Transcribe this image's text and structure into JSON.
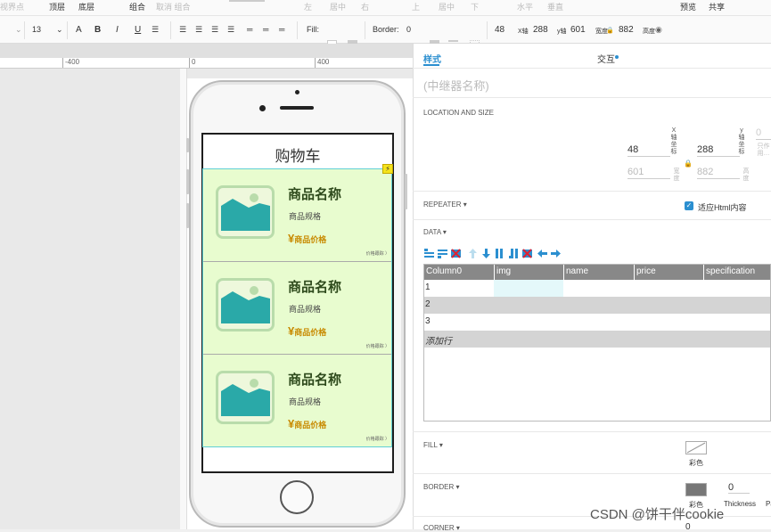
{
  "toolbar_row1": {
    "left_truncated": "视界点",
    "top_layer": "顶层",
    "bottom_layer": "底层",
    "group": "组合",
    "ungroup": "取消 组合",
    "align_left": "左",
    "align_center": "居中",
    "align_right": "右",
    "align_top": "上",
    "align_middle": "居中",
    "align_bottom": "下",
    "distribute_h": "水平",
    "distribute_v": "垂直",
    "preview": "预览",
    "share": "共享"
  },
  "toolbar_row2": {
    "font_size": "13",
    "fill_label": "Fill:",
    "border_label": "Border:",
    "border_value": "0",
    "x_value": "48",
    "x_label": "X轴",
    "y_value": "288",
    "y_label": "y轴",
    "w_value": "601",
    "w_label": "宽度",
    "h_value": "882",
    "h_label": "高度"
  },
  "ruler": {
    "labels": [
      "-400",
      "0",
      "400"
    ]
  },
  "phone_screen": {
    "title": "购物车",
    "flash": "⚡",
    "items": [
      {
        "name": "商品名称",
        "spec": "商品规格",
        "yen": "¥",
        "price": "商品价格",
        "detail": "价格跟踪 〉"
      },
      {
        "name": "商品名称",
        "spec": "商品规格",
        "yen": "¥",
        "price": "商品价格",
        "detail": "价格跟踪 〉"
      },
      {
        "name": "商品名称",
        "spec": "商品规格",
        "yen": "¥",
        "price": "商品价格",
        "detail": "价格跟踪 〉"
      }
    ]
  },
  "panel": {
    "tab_style": "样式",
    "tab_interaction": "交互",
    "name_placeholder": "(中继器名称)",
    "location_title": "LOCATION AND SIZE",
    "x_axis_label": "X\n轴\n坐\n标",
    "y_axis_label": "y\n轴\n坐\n标",
    "x": "48",
    "y": "288",
    "z_truncated": "0",
    "w": "601",
    "h": "882",
    "w_label": "宽\n度",
    "h_label": "高\n度",
    "only_visible": "只作用…",
    "repeater_title": "REPEATER ▾",
    "fit_html": "适应Html内容",
    "data_title": "DATA ▾",
    "fill_title": "FILL ▾",
    "fill_color_label": "彩色",
    "border_title": "BORDER ▾",
    "border_color_label": "彩色",
    "border_thickness": "0",
    "thickness_label": "Thickness",
    "pattern_truncated": "Pa",
    "corner_title": "CORNER ▾",
    "corner_value": "0"
  },
  "data_grid": {
    "columns": [
      "Column0",
      "img",
      "name",
      "price",
      "specification"
    ],
    "rows": [
      "1",
      "2",
      "3"
    ],
    "add_row": "添加行"
  },
  "watermark": "CSDN @饼干伴cookie",
  "colors": {
    "accent": "#2b8fd0",
    "item_bg": "#e8fccf",
    "repeater_border": "#60d0d6",
    "price": "#c88a00",
    "image_teal": "#2aa9a8"
  }
}
